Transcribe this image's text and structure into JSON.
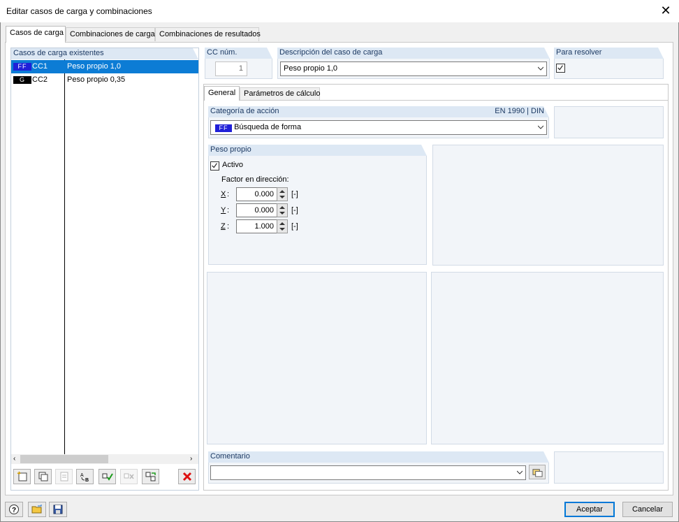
{
  "window": {
    "title": "Editar casos de carga y combinaciones"
  },
  "tabs": [
    "Casos de carga",
    "Combinaciones de carga",
    "Combinaciones de resultados"
  ],
  "list": {
    "header": "Casos de carga existentes",
    "items": [
      {
        "badge": "FF",
        "id": "CC1",
        "description": "Peso propio 1,0",
        "selected": true,
        "badge_color": "#1f1fd8"
      },
      {
        "badge": "G",
        "id": "CC2",
        "description": "Peso propio 0,35",
        "selected": false,
        "badge_color": "#000000"
      }
    ]
  },
  "cc_num": {
    "label": "CC núm.",
    "value": "1"
  },
  "descripcion": {
    "label": "Descripción del caso de carga",
    "value": "Peso propio 1,0"
  },
  "para_resolver": {
    "label": "Para resolver",
    "checked": true
  },
  "subtabs": [
    "General",
    "Parámetros de cálculo"
  ],
  "categoria": {
    "label": "Categoría de acción",
    "norm": "EN 1990 | DIN",
    "badge": "FF",
    "value": "Búsqueda de forma"
  },
  "peso_propio": {
    "label": "Peso propio",
    "activo_label": "Activo",
    "factor_label": "Factor en dirección:",
    "unit": "[-]",
    "rows": [
      {
        "axis": "X",
        "sep": ":",
        "value": "0.000"
      },
      {
        "axis": "Y",
        "sep": ":",
        "value": "0.000"
      },
      {
        "axis": "Z",
        "sep": ":",
        "value": "1.000"
      }
    ]
  },
  "comentario": {
    "label": "Comentario",
    "value": ""
  },
  "buttons": {
    "accept": "Aceptar",
    "cancel": "Cancelar"
  },
  "colors": {
    "selection": "#0c7cd5",
    "group_header": "#dde8f4",
    "accent": "#0078d7"
  }
}
